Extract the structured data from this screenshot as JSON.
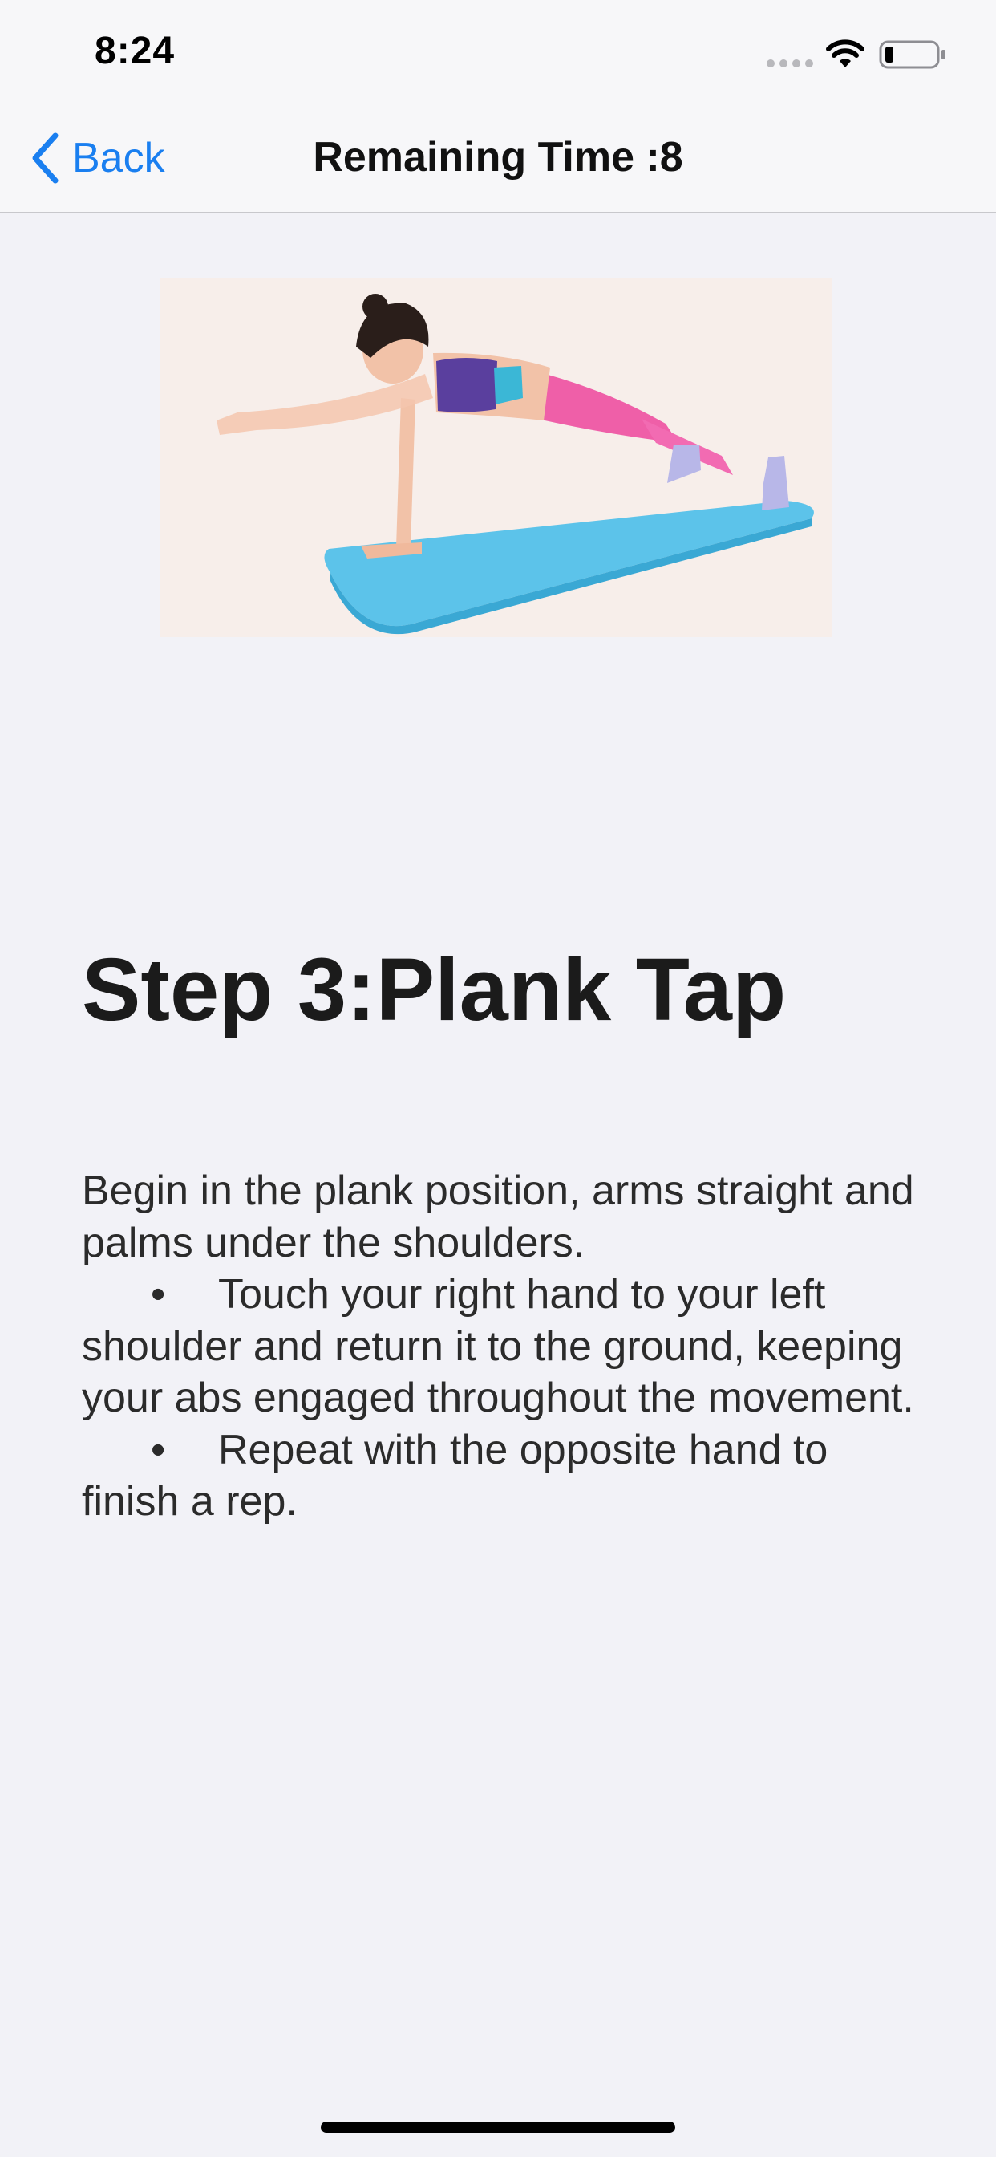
{
  "status_bar": {
    "time": "8:24",
    "icons": [
      "signal-dots-icon",
      "wifi-icon",
      "battery-icon"
    ],
    "battery_level": 0.15
  },
  "nav": {
    "back_label": "Back",
    "title": "Remaining Time :8",
    "accent_color": "#1a7ff0"
  },
  "exercise": {
    "step_title": "Step 3:Plank Tap",
    "intro": "Begin in the plank position, arms straight and palms under the shoulders.",
    "bullet_symbol": "•",
    "bullets": [
      "Touch your right hand to your left shoulder and return it to the ground, keeping your abs engaged throughout the movement.",
      "Repeat with the opposite hand to finish a rep."
    ]
  }
}
